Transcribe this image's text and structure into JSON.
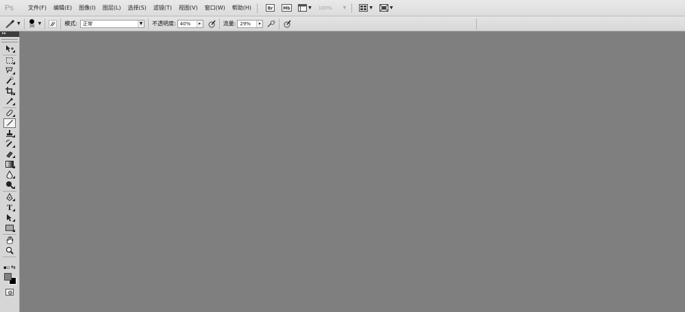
{
  "app": {
    "logo": "Ps"
  },
  "menu": {
    "items": [
      "文件(F)",
      "编辑(E)",
      "图像(I)",
      "图层(L)",
      "选择(S)",
      "滤镜(T)",
      "视图(V)",
      "窗口(W)",
      "帮助(H)"
    ],
    "br_label": "Br",
    "mb_label": "Mb",
    "zoom": "100%"
  },
  "options": {
    "brush_size": "30",
    "mode_label": "模式:",
    "mode_value": "正常",
    "opacity_label": "不透明度:",
    "opacity_value": "40%",
    "flow_label": "流量:",
    "flow_value": "29%"
  },
  "tools": [
    "move-tool",
    "marquee-tool",
    "lasso-tool",
    "quick-selection-tool",
    "crop-tool",
    "eyedropper-tool",
    "spot-healing-tool",
    "brush-tool",
    "clone-stamp-tool",
    "history-brush-tool",
    "eraser-tool",
    "gradient-tool",
    "blur-tool",
    "dodge-tool",
    "pen-tool",
    "type-tool",
    "path-selection-tool",
    "rectangle-tool",
    "hand-tool",
    "zoom-tool"
  ],
  "colors": {
    "foreground": "#808080",
    "background": "#000000",
    "canvas": "#7f7f7f"
  }
}
